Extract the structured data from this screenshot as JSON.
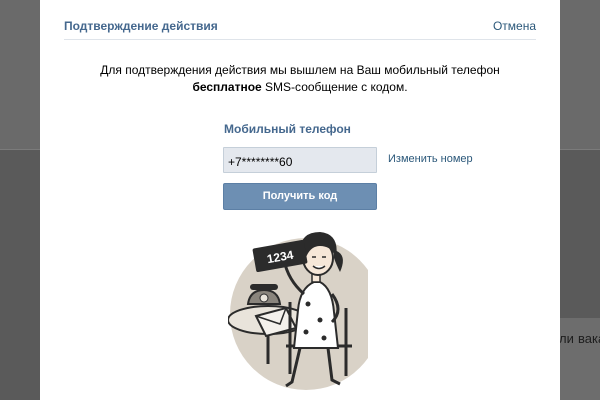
{
  "dialog": {
    "title": "Подтверждение действия",
    "cancel_label": "Отмена",
    "info_line1": "Для подтверждения действия мы вышлем на Ваш мобильный телефон",
    "info_bold": "бесплатное",
    "info_rest": " SMS-сообщение с кодом.",
    "phone_label": "Мобильный телефон",
    "phone_value": "+7********60",
    "change_number_label": "Изменить номер",
    "get_code_label": "Получить код",
    "illustration": {
      "icon": "woman-holding-code-sign-illustration",
      "sign_text": "1234"
    }
  },
  "background": {
    "text_fragment_1": "ли",
    "text_fragment_2": "вака"
  },
  "colors": {
    "overlay": "#5a5a5a",
    "modal_bg": "#ffffff",
    "title_color": "#45688e",
    "link_color": "#2b587a",
    "button_bg": "#6d8fb3",
    "input_bg": "#e4e8ee",
    "divider": "#dfe4ea"
  }
}
